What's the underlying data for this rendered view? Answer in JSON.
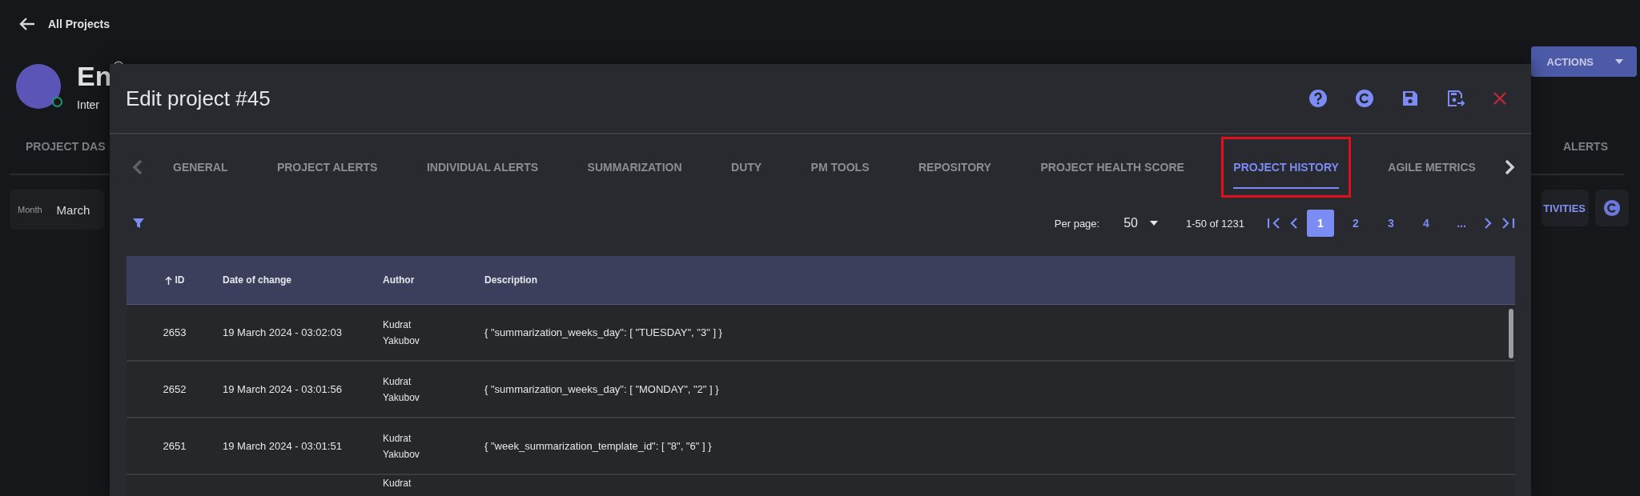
{
  "page": {
    "back_link": "All Projects",
    "project_title": "En",
    "project_subtitle": "Inter",
    "online": true,
    "tabs": [
      {
        "label": "PROJECT DAS",
        "selected": false
      },
      {
        "label": "ALERTS",
        "selected": false
      }
    ],
    "filter": {
      "label": "Month",
      "value": "March"
    },
    "activities_button": "TIVITIES",
    "actions_button": "ACTIONS"
  },
  "modal": {
    "title": "Edit project #45",
    "tabs": [
      {
        "label": "GENERAL",
        "selected": false,
        "highlighted": false
      },
      {
        "label": "PROJECT ALERTS",
        "selected": false,
        "highlighted": false
      },
      {
        "label": "INDIVIDUAL ALERTS",
        "selected": false,
        "highlighted": false
      },
      {
        "label": "SUMMARIZATION",
        "selected": false,
        "highlighted": false
      },
      {
        "label": "DUTY",
        "selected": false,
        "highlighted": false
      },
      {
        "label": "PM TOOLS",
        "selected": false,
        "highlighted": false
      },
      {
        "label": "REPOSITORY",
        "selected": false,
        "highlighted": false
      },
      {
        "label": "PROJECT HEALTH SCORE",
        "selected": false,
        "highlighted": false
      },
      {
        "label": "PROJECT HISTORY",
        "selected": true,
        "highlighted": true
      },
      {
        "label": "AGILE METRICS",
        "selected": false,
        "highlighted": false
      }
    ],
    "pagination": {
      "per_page_label": "Per page:",
      "per_page": "50",
      "range": "1-50 of 1231",
      "pages": [
        {
          "label": "1",
          "selected": true
        },
        {
          "label": "2",
          "selected": false
        },
        {
          "label": "3",
          "selected": false
        },
        {
          "label": "4",
          "selected": false
        },
        {
          "label": "...",
          "selected": false
        }
      ]
    },
    "table": {
      "columns": [
        {
          "label": "ID",
          "sorted": true
        },
        {
          "label": "Date of change",
          "sorted": false
        },
        {
          "label": "Author",
          "sorted": false
        },
        {
          "label": "Description",
          "sorted": false
        }
      ],
      "rows": [
        {
          "id": "2653",
          "date": "19 March 2024 - 03:02:03",
          "author": "Kudrat Yakubov",
          "description": "{ \"summarization_weeks_day\": [ \"TUESDAY\", \"3\" ] }"
        },
        {
          "id": "2652",
          "date": "19 March 2024 - 03:01:56",
          "author": "Kudrat Yakubov",
          "description": "{ \"summarization_weeks_day\": [ \"MONDAY\", \"2\" ] }"
        },
        {
          "id": "2651",
          "date": "19 March 2024 - 03:01:51",
          "author": "Kudrat Yakubov",
          "description": "{ \"week_summarization_template_id\": [ \"8\", \"6\" ] }"
        },
        {
          "author": "Kudrat"
        }
      ]
    }
  }
}
